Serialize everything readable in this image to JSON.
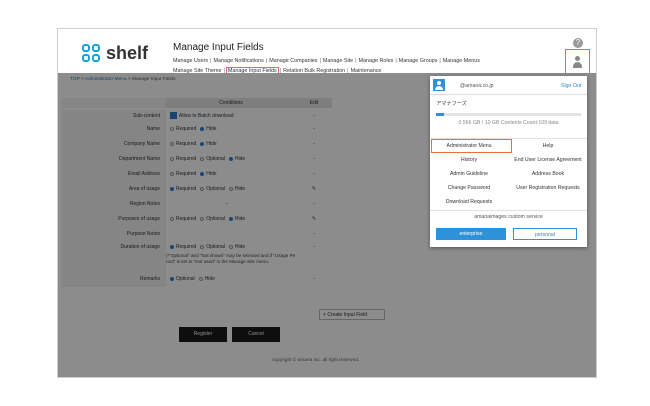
{
  "app": {
    "logo_text": "shelf",
    "page_title": "Manage Input Fields"
  },
  "nav": {
    "items": [
      "Manage Users",
      "Manage Notifications",
      "Manage Companies",
      "Manage Site",
      "Manage Roles",
      "Manage Groups",
      "Manage Menus",
      "Manage Site Theme",
      "Manage Input Fields",
      "Relation Bulk Registration",
      "Maintenance"
    ],
    "separator": "|"
  },
  "header": {
    "help_glyph": "?"
  },
  "breadcrumb": {
    "top": "TOP",
    "admin": "Administrator Menu",
    "current": "Manage Input Fields",
    "sep": ">"
  },
  "form": {
    "col_conditions": "Conditions",
    "col_edit": "Edit",
    "rows": [
      {
        "label": "Sub-content",
        "options": [
          {
            "text": "Allow to Batch download",
            "type": "check",
            "on": true
          }
        ],
        "edit": "-"
      },
      {
        "label": "Name",
        "options": [
          {
            "text": "Required",
            "on": false
          },
          {
            "text": "Hide",
            "on": true
          }
        ],
        "edit": "-"
      },
      {
        "label": "Company Name",
        "options": [
          {
            "text": "Required",
            "on": false
          },
          {
            "text": "Hide",
            "on": true
          }
        ],
        "edit": "-"
      },
      {
        "label": "Department Name",
        "options": [
          {
            "text": "Required",
            "on": false
          },
          {
            "text": "Optional",
            "on": false
          },
          {
            "text": "Hide",
            "on": true
          }
        ],
        "edit": "-"
      },
      {
        "label": "Email Address",
        "options": [
          {
            "text": "Required",
            "on": false
          },
          {
            "text": "Hide",
            "on": true
          }
        ],
        "edit": "-"
      },
      {
        "label": "Area of usage",
        "options": [
          {
            "text": "Required",
            "on": true
          },
          {
            "text": "Optional",
            "on": false
          },
          {
            "text": "Hide",
            "on": false
          }
        ],
        "edit": ""
      },
      {
        "label": "Region Notes",
        "options": [],
        "edit": "-",
        "cond_text": "-"
      },
      {
        "label": "Purposes of usage",
        "options": [
          {
            "text": "Required",
            "on": false
          },
          {
            "text": "Optional",
            "on": false
          },
          {
            "text": "Hide",
            "on": true
          }
        ],
        "edit": ""
      },
      {
        "label": "Purpose Notes",
        "options": [],
        "edit": "-"
      },
      {
        "label": "Duration of usage",
        "options": [
          {
            "text": "Required",
            "on": true
          },
          {
            "text": "Optional",
            "on": false
          },
          {
            "text": "Hide",
            "on": false
          }
        ],
        "edit": "-"
      },
      {
        "label": "Remarks",
        "options": [
          {
            "text": "Optional",
            "on": true
          },
          {
            "text": "Hide",
            "on": false
          }
        ],
        "edit": "-"
      }
    ],
    "duration_note": "(*\"Optional\" and \"Not shown\" may be selected and if \"Usage Pe riod\" is set to \"Not used\" in the Manage Site menu."
  },
  "buttons": {
    "create": "Create Input Field",
    "register": "Register",
    "cancel": "Cancel",
    "create_glyph": "+"
  },
  "footer": {
    "copyright": "copyright © amana inc. all right reserved."
  },
  "panel": {
    "email": "@amana.co.jp",
    "sign_out": "Sign Out",
    "org": "アマナフーズ",
    "usage": "0.566 GB / 10 GB  Contents Count:109  data",
    "usage_fraction": 0.057,
    "menu": [
      [
        "Administrator Menu",
        "Help"
      ],
      [
        "History",
        "End User License Agreement"
      ],
      [
        "Admin Guideline",
        "Address Book"
      ],
      [
        "Change Password",
        "User Registration Requests"
      ],
      [
        "Download Requests",
        ""
      ]
    ],
    "service": "amanaimages custom service",
    "btn_enterprise": "enterprise",
    "btn_personal": "personal"
  },
  "colors": {
    "accent": "#2e92d8",
    "highlight": "#e8703a",
    "dark_button": "#1a1a1a"
  }
}
